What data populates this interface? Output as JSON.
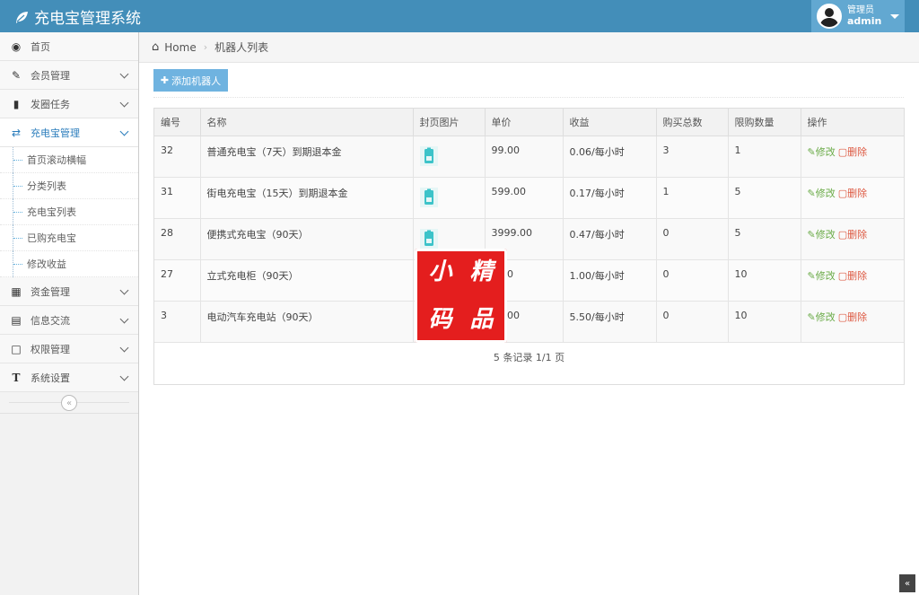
{
  "app": {
    "title": "充电宝管理系统"
  },
  "user": {
    "role": "管理员",
    "name": "admin"
  },
  "sidebar": {
    "items": [
      {
        "label": "首页",
        "icon": "dashboard-icon"
      },
      {
        "label": "会员管理",
        "icon": "edit-icon"
      },
      {
        "label": "发圈任务",
        "icon": "book-icon"
      },
      {
        "label": "充电宝管理",
        "icon": "shuffle-icon",
        "active": true
      },
      {
        "label": "资金管理",
        "icon": "calendar-icon"
      },
      {
        "label": "信息交流",
        "icon": "list-icon"
      },
      {
        "label": "权限管理",
        "icon": "file-icon"
      },
      {
        "label": "系统设置",
        "icon": "text-icon"
      }
    ],
    "subitems": [
      "首页滚动横幅",
      "分类列表",
      "充电宝列表",
      "已购充电宝",
      "修改收益"
    ]
  },
  "breadcrumb": {
    "home": "Home",
    "current": "机器人列表"
  },
  "toolbar": {
    "add_label": "添加机器人"
  },
  "table": {
    "headers": [
      "编号",
      "名称",
      "封页图片",
      "单价",
      "收益",
      "购买总数",
      "限购数量",
      "操作"
    ],
    "rows": [
      {
        "id": "32",
        "name": "普通充电宝（7天）到期退本金",
        "price": "99.00",
        "income": "0.06/每小时",
        "total": "3",
        "limit": "1"
      },
      {
        "id": "31",
        "name": "街电充电宝（15天）到期退本金",
        "price": "599.00",
        "income": "0.17/每小时",
        "total": "1",
        "limit": "5"
      },
      {
        "id": "28",
        "name": "便携式充电宝（90天）",
        "price": "3999.00",
        "income": "0.47/每小时",
        "total": "0",
        "limit": "5"
      },
      {
        "id": "27",
        "name": "立式充电柜（90天）",
        "price": "9.00",
        "income": "1.00/每小时",
        "total": "0",
        "limit": "10"
      },
      {
        "id": "3",
        "name": "电动汽车充电站（90天）",
        "price": "00.00",
        "income": "5.50/每小时",
        "total": "0",
        "limit": "10"
      }
    ],
    "edit_label": "修改",
    "delete_label": "删除",
    "pager": "5 条记录 1/1 页"
  },
  "watermark": {
    "chars": [
      "小",
      "精",
      "码",
      "品"
    ]
  },
  "colors": {
    "navbar": "#438eb9",
    "accent": "#2b7dbc",
    "edit": "#69aa46",
    "delete": "#dd5a43",
    "add_button": "#6fb3e0"
  }
}
